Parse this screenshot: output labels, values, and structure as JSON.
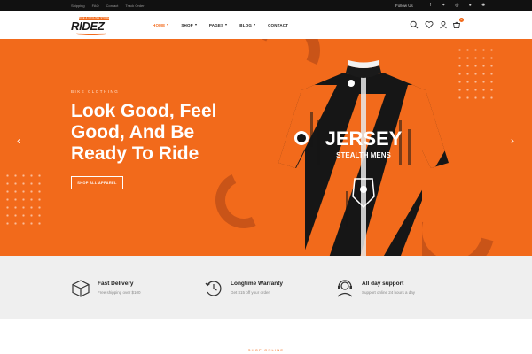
{
  "topbar": {
    "links": [
      "Shipping",
      "FAQ",
      "Contact",
      "Track Order"
    ],
    "follow_label": "Follow Us"
  },
  "header": {
    "logo_text": "RIDEZ",
    "logo_tag": "BIKE & CYCLING STORE",
    "nav": [
      {
        "label": "HOME",
        "active": true,
        "has_caret": true
      },
      {
        "label": "SHOP",
        "active": false,
        "has_caret": true
      },
      {
        "label": "PAGES",
        "active": false,
        "has_caret": true
      },
      {
        "label": "BLOG",
        "active": false,
        "has_caret": true
      },
      {
        "label": "CONTACT",
        "active": false,
        "has_caret": false
      }
    ],
    "cart_count": "0",
    "icons": [
      "search-icon",
      "heart-icon",
      "user-icon",
      "cart-icon"
    ]
  },
  "hero": {
    "eyebrow": "BIKE CLOTHING",
    "headline": [
      "Look Good, Feel",
      "Good, And Be",
      "Ready To Ride"
    ],
    "cta_label": "SHOP ALL APPAREL",
    "jersey_text": "JERSEY",
    "jersey_subtext": "STEALTH MENS"
  },
  "features": [
    {
      "icon": "delivery-box-icon",
      "title": "Fast Delivery",
      "subtitle": "Free shipping over $100"
    },
    {
      "icon": "warranty-clock-icon",
      "title": "Longtime Warranty",
      "subtitle": "Get $15 off your order"
    },
    {
      "icon": "support-headset-icon",
      "title": "All day support",
      "subtitle": "Support online 24 hours a day"
    }
  ],
  "section_label": "SHOP ONLINE",
  "colors": {
    "accent": "#f26a1b",
    "topbar": "#111111",
    "features_bg": "#efefef"
  }
}
